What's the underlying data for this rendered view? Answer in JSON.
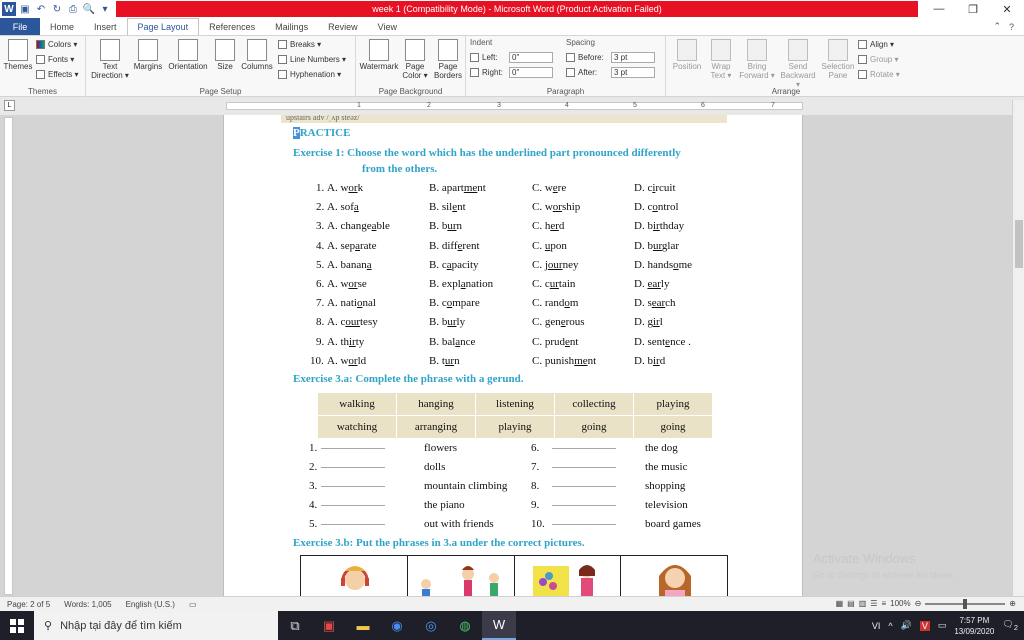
{
  "titlebar": {
    "title": "week 1 (Compatibility Mode)  -  Microsoft Word (Product Activation Failed)",
    "minimize": "—",
    "restore": "❐",
    "close": "✕"
  },
  "tabs": {
    "file": "File",
    "items": [
      "Home",
      "Insert",
      "Page Layout",
      "References",
      "Mailings",
      "Review",
      "View"
    ],
    "active": "Page Layout"
  },
  "ribbon": {
    "themes": {
      "themes": "Themes",
      "colors": "Colors ▾",
      "fonts": "Fonts ▾",
      "effects": "Effects ▾",
      "label": "Themes"
    },
    "page_setup": {
      "text_direction": "Text Direction ▾",
      "margins": "Margins",
      "orientation": "Orientation",
      "size": "Size",
      "columns": "Columns",
      "breaks": "Breaks ▾",
      "line_numbers": "Line Numbers ▾",
      "hyphenation": "Hyphenation ▾",
      "label": "Page Setup"
    },
    "page_background": {
      "watermark": "Watermark",
      "page_color": "Page Color ▾",
      "page_borders": "Page Borders",
      "label": "Page Background"
    },
    "paragraph": {
      "indent": "Indent",
      "left": "Left:",
      "left_value": "0\"",
      "right": "Right:",
      "right_value": "0\"",
      "spacing": "Spacing",
      "before": "Before:",
      "before_value": "3 pt",
      "after": "After:",
      "after_value": "3 pt",
      "label": "Paragraph"
    },
    "arrange": {
      "position": "Position",
      "wrap_text": "Wrap Text ▾",
      "bring_forward": "Bring Forward ▾",
      "send_backward": "Send Backward ▾",
      "selection_pane": "Selection Pane",
      "align": "Align ▾",
      "group": "Group ▾",
      "rotate": "Rotate ▾",
      "label": "Arrange"
    }
  },
  "document": {
    "practice_heading": "PRACTICE",
    "practice_first": "P",
    "practice_rest": "RACTICE",
    "ex1_line1": "Exercise 1: Choose the word which has the underlined part pronounced differently",
    "ex1_line2": "from the others.",
    "questions": [
      {
        "n": "1.",
        "a": [
          "A. w",
          "or",
          "k"
        ],
        "b": [
          "B. apart",
          "me",
          "nt"
        ],
        "c": [
          "C. w",
          "e",
          "re"
        ],
        "d": [
          "D. c",
          "i",
          "rcuit"
        ]
      },
      {
        "n": "2.",
        "a": [
          "A. sof",
          "a",
          ""
        ],
        "b": [
          "B. sil",
          "e",
          "nt"
        ],
        "c": [
          "C. w",
          "or",
          "ship"
        ],
        "d": [
          "D. c",
          "o",
          "ntrol"
        ]
      },
      {
        "n": "3.",
        "a": [
          "A. change",
          "a",
          "ble"
        ],
        "b": [
          "B. b",
          "ur",
          "n"
        ],
        "c": [
          "C. h",
          "er",
          "d"
        ],
        "d": [
          "D. b",
          "ir",
          "thday"
        ]
      },
      {
        "n": "4.",
        "a": [
          "A. sep",
          "a",
          "rate"
        ],
        "b": [
          "B. diff",
          "e",
          "rent"
        ],
        "c": [
          "C. ",
          "u",
          "pon"
        ],
        "d": [
          "D. b",
          "ur",
          "glar"
        ]
      },
      {
        "n": "5.",
        "a": [
          "A. banan",
          "a",
          ""
        ],
        "b": [
          "B. c",
          "a",
          "pacity"
        ],
        "c": [
          "C. j",
          "our",
          "ney"
        ],
        "d": [
          "D. hands",
          "o",
          "me"
        ]
      },
      {
        "n": "6.",
        "a": [
          "A. w",
          "or",
          "se"
        ],
        "b": [
          "B. expl",
          "a",
          "nation"
        ],
        "c": [
          "C. c",
          "ur",
          "tain"
        ],
        "d": [
          "D. ",
          "ear",
          "ly"
        ]
      },
      {
        "n": "7.",
        "a": [
          "A. nati",
          "o",
          "nal"
        ],
        "b": [
          "B. c",
          "o",
          "mpare"
        ],
        "c": [
          "C. rand",
          "o",
          "m"
        ],
        "d": [
          "D. s",
          "ear",
          "ch"
        ]
      },
      {
        "n": "8.",
        "a": [
          "A. c",
          "our",
          "tesy"
        ],
        "b": [
          "B. b",
          "ur",
          "ly"
        ],
        "c": [
          "C. gen",
          "e",
          "rous"
        ],
        "d": [
          "D. g",
          "ir",
          "l"
        ]
      },
      {
        "n": "9.",
        "a": [
          "A. th",
          "ir",
          "ty"
        ],
        "b": [
          "B. bal",
          "a",
          "nce"
        ],
        "c": [
          "C. prud",
          "e",
          "nt"
        ],
        "d": [
          "D. sent",
          "e",
          "nce ."
        ]
      },
      {
        "n": "10.",
        "a": [
          "A. w",
          "or",
          "ld"
        ],
        "b": [
          "B. t",
          "ur",
          "n"
        ],
        "c": [
          "C. punish",
          "me",
          "nt"
        ],
        "d": [
          "D. b",
          "ir",
          "d"
        ]
      }
    ],
    "ex3a": "Exercise 3.a: Complete the phrase with a gerund.",
    "gerund_table": [
      [
        "walking",
        "hanging",
        "listening",
        "collecting",
        "playing"
      ],
      [
        "watching",
        "arranging",
        "playing",
        "going",
        "going"
      ]
    ],
    "blanks": [
      {
        "n1": "1.",
        "p1": "flowers",
        "n2": "6.",
        "p2": "the dog"
      },
      {
        "n1": "2.",
        "p1": "dolls",
        "n2": "7.",
        "p2": "the music"
      },
      {
        "n1": "3.",
        "p1": "mountain climbing",
        "n2": "8.",
        "p2": "shopping"
      },
      {
        "n1": "4.",
        "p1": "the piano",
        "n2": "9.",
        "p2": "television"
      },
      {
        "n1": "5.",
        "p1": "out with friends",
        "n2": "10.",
        "p2": "board games"
      }
    ],
    "dots": "................................",
    "ex3b": "Exercise 3.b: Put the phrases in 3.a under the correct pictures.",
    "top_strip": "upstairs                    adv         /ˌʌp steəz/"
  },
  "watermark": {
    "line1": "Activate Windows",
    "line2": "Go to Settings to activate Windows."
  },
  "statusbar": {
    "page": "Page: 2 of 5",
    "words": "Words: 1,005",
    "lang": "English (U.S.)",
    "zoom": "100%",
    "zoom_level": 0.5
  },
  "taskbar": {
    "search_placeholder": "Nhập tại đây để tìm kiếm",
    "lang": "VI",
    "time": "7:57 PM",
    "date": "13/09/2020",
    "notifications": "2"
  }
}
